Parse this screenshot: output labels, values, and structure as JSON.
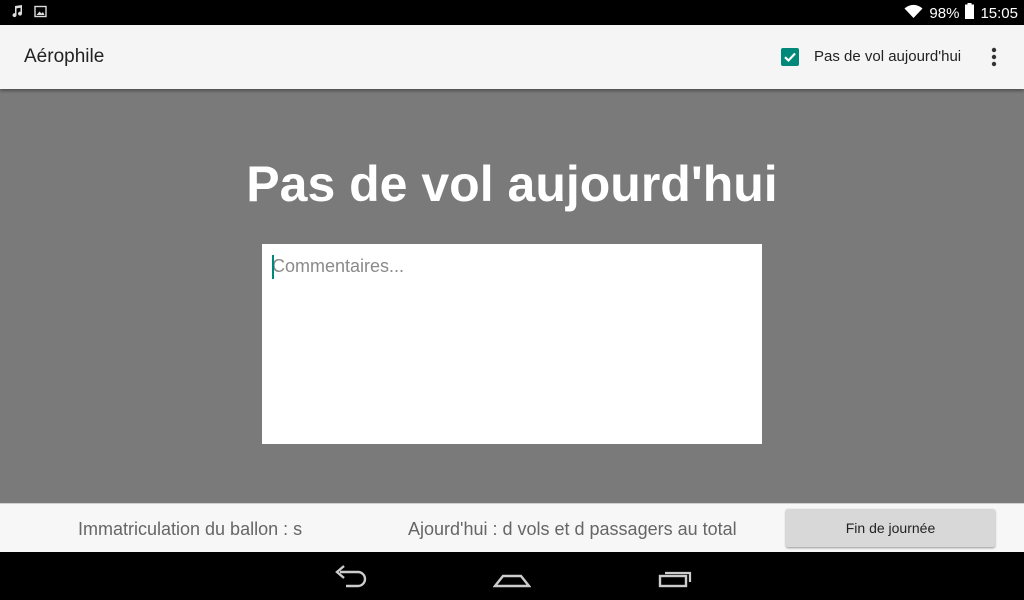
{
  "status_bar": {
    "battery": "98%",
    "time": "15:05",
    "icons": [
      "music-notification-icon",
      "image-notification-icon",
      "wifi-icon",
      "battery-icon"
    ]
  },
  "app_bar": {
    "title": "Aérophile",
    "checkbox_label": "Pas de vol aujourd'hui",
    "checkbox_checked": true,
    "overflow_icon": "more-vert-icon"
  },
  "main": {
    "heading": "Pas de vol aujourd'hui",
    "comment": {
      "value": "",
      "placeholder": "Commentaires..."
    }
  },
  "bottom_bar": {
    "immatriculation": "Immatriculation du ballon : s",
    "today_summary": "Ajourd'hui : d vols et d passagers au total",
    "end_button": "Fin de journée"
  },
  "nav_bar": {
    "icons": [
      "back-icon",
      "home-icon",
      "recents-icon"
    ]
  },
  "colors": {
    "accent": "#00897b",
    "content_background": "#7a7a7a",
    "app_bar_background": "#f5f5f5"
  }
}
